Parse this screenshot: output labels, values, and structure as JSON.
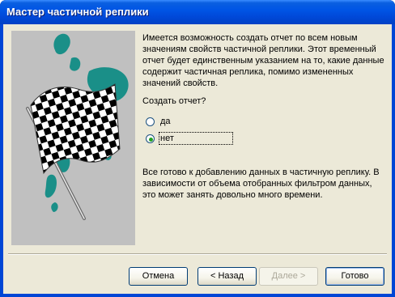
{
  "window": {
    "title": "Мастер частичной реплики"
  },
  "description": "Имеется возможность создать отчет по всем новым значениям свойств частичной реплики. Этот временный отчет будет единственным указанием на то, какие данные содержит частичная реплика, помимо измененных значений свойств.",
  "question": "Создать отчет?",
  "options": [
    {
      "label": "да",
      "selected": false
    },
    {
      "label": "нет",
      "selected": true
    }
  ],
  "info": "Все готово к добавлению данных в частичную реплику. В зависимости от объема отобранных фильтром данных, это может занять довольно много времени.",
  "buttons": {
    "cancel": "Отмена",
    "back": "< Назад",
    "next": "Далее >",
    "finish": "Готово"
  },
  "colors": {
    "title_bar": "#0055e5",
    "dialog_bg": "#ece9d8",
    "art_bg": "#c0c0c0",
    "teal_splash": "#1a8f88",
    "radio_dot": "#21a121"
  }
}
